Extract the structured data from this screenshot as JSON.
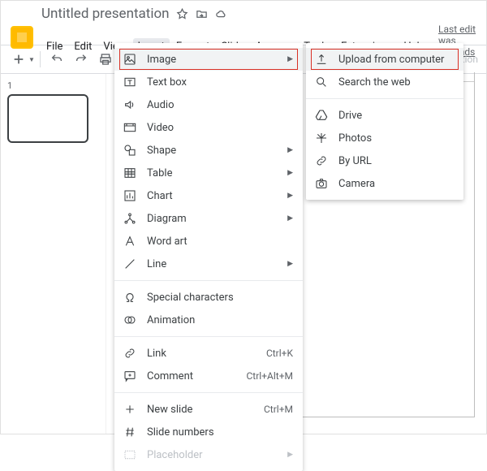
{
  "doc": {
    "title": "Untitled presentation",
    "last_edit": "Last edit was seconds ago",
    "thumb_num": "1"
  },
  "menubar": [
    "File",
    "Edit",
    "View",
    "Insert",
    "Format",
    "Slide",
    "Arrange",
    "Tools",
    "Extensions",
    "Help"
  ],
  "toolbar_hint": "tion",
  "insert_menu": {
    "g1": [
      {
        "id": "image",
        "label": "Image",
        "arrow": true
      },
      {
        "id": "textbox",
        "label": "Text box"
      },
      {
        "id": "audio",
        "label": "Audio"
      },
      {
        "id": "video",
        "label": "Video"
      },
      {
        "id": "shape",
        "label": "Shape",
        "arrow": true
      },
      {
        "id": "table",
        "label": "Table",
        "arrow": true
      },
      {
        "id": "chart",
        "label": "Chart",
        "arrow": true
      },
      {
        "id": "diagram",
        "label": "Diagram",
        "arrow": true
      },
      {
        "id": "wordart",
        "label": "Word art"
      },
      {
        "id": "line",
        "label": "Line",
        "arrow": true
      }
    ],
    "g2": [
      {
        "id": "specialchars",
        "label": "Special characters"
      },
      {
        "id": "animation",
        "label": "Animation"
      }
    ],
    "g3": [
      {
        "id": "link",
        "label": "Link",
        "shortcut": "Ctrl+K"
      },
      {
        "id": "comment",
        "label": "Comment",
        "shortcut": "Ctrl+Alt+M"
      }
    ],
    "g4": [
      {
        "id": "newslide",
        "label": "New slide",
        "shortcut": "Ctrl+M"
      },
      {
        "id": "slidenumbers",
        "label": "Slide numbers"
      },
      {
        "id": "placeholder",
        "label": "Placeholder",
        "arrow": true,
        "disabled": true
      }
    ]
  },
  "image_submenu": {
    "g1": [
      {
        "id": "upload",
        "label": "Upload from computer"
      },
      {
        "id": "searchweb",
        "label": "Search the web"
      }
    ],
    "g2": [
      {
        "id": "drive",
        "label": "Drive"
      },
      {
        "id": "photos",
        "label": "Photos"
      },
      {
        "id": "byurl",
        "label": "By URL"
      },
      {
        "id": "camera",
        "label": "Camera"
      }
    ]
  }
}
